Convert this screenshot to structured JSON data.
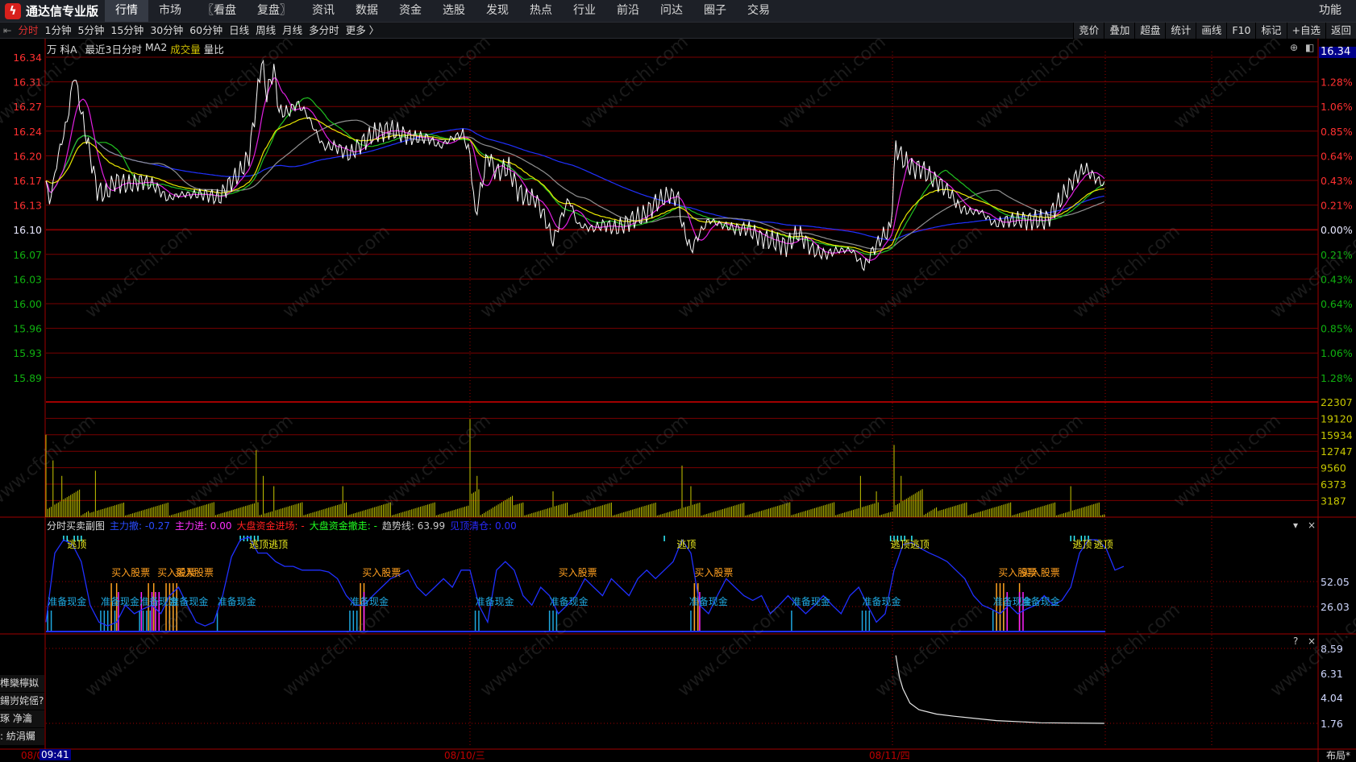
{
  "app": {
    "title": "通达信专业版",
    "logo_icon": "tdx-logo-icon"
  },
  "menu": [
    {
      "label": "行情",
      "active": true
    },
    {
      "label": "市场"
    },
    {
      "label": "〖看盘"
    },
    {
      "label": "复盘〗"
    },
    {
      "label": "资讯"
    },
    {
      "label": "数据"
    },
    {
      "label": "资金"
    },
    {
      "label": "选股"
    },
    {
      "label": "发现"
    },
    {
      "label": "热点"
    },
    {
      "label": "行业"
    },
    {
      "label": "前沿"
    },
    {
      "label": "问达"
    },
    {
      "label": "圈子"
    },
    {
      "label": "交易"
    }
  ],
  "func_label": "功能",
  "periods": [
    {
      "label": "分时",
      "active": true
    },
    {
      "label": "1分钟"
    },
    {
      "label": "5分钟"
    },
    {
      "label": "15分钟"
    },
    {
      "label": "30分钟"
    },
    {
      "label": "60分钟"
    },
    {
      "label": "日线"
    },
    {
      "label": "周线"
    },
    {
      "label": "月线"
    },
    {
      "label": "多分时"
    },
    {
      "label": "更多 〉"
    }
  ],
  "right_tools": [
    "竞价",
    "叠加",
    "超盘",
    "统计",
    "画线",
    "F10",
    "标记",
    "+自选",
    "返回"
  ],
  "title_row": {
    "stock": "万 科A",
    "mode": "最近3日分时",
    "ma": "MA2",
    "volume": "成交量",
    "ratio": "量比"
  },
  "current_price_tag": "16.34",
  "price_axis": {
    "base": 16.1,
    "left": [
      "16.34",
      "16.31",
      "16.27",
      "16.24",
      "16.20",
      "16.17",
      "16.13",
      "16.10",
      "16.07",
      "16.03",
      "16.00",
      "15.96",
      "15.93",
      "15.89"
    ],
    "right": [
      "1.28%",
      "1.06%",
      "0.85%",
      "0.64%",
      "0.43%",
      "0.21%",
      "0.00%",
      "0.21%",
      "0.43%",
      "0.64%",
      "0.85%",
      "1.06%",
      "1.28%"
    ]
  },
  "volume_axis": [
    "22307",
    "19120",
    "15934",
    "12747",
    "9560",
    "6373",
    "3187"
  ],
  "sub1": {
    "title": "分时买卖副图",
    "items": [
      {
        "label": "主力撤: -0.27",
        "color": "#2a4cff"
      },
      {
        "label": "主力进: 0.00",
        "color": "#ff30ff"
      },
      {
        "label": "大盘资金进场: -",
        "color": "#ff2020"
      },
      {
        "label": "大盘资金撤走: -",
        "color": "#20ff20"
      },
      {
        "label": "趋势线: 63.99",
        "color": "#c8c8c8"
      },
      {
        "label": "见顶清仓: 0.00",
        "color": "#2a2aff"
      }
    ],
    "axis": [
      "52.05",
      "26.03"
    ]
  },
  "sub2": {
    "axis": [
      "8.59",
      "6.31",
      "4.04",
      "1.76"
    ],
    "help": "?",
    "close": "×"
  },
  "sub1_controls": {
    "menu": "▾",
    "close": "×"
  },
  "side_items": [
    "榫欒檸姒",
    "鍚岃姹傜?",
    "琢   净瀹",
    ":  紡涓孎"
  ],
  "time_axis": {
    "dates": [
      "08/0",
      "08/10/三",
      "08/11/四"
    ],
    "cursor_time": "09:41",
    "layout": "布局*"
  },
  "watermark": "www.cfchi.com",
  "colors": {
    "up": "#ff3030",
    "down": "#10b010",
    "grid": "#7a0000",
    "volume": "#c8c800"
  },
  "chart_data": {
    "type": "line",
    "minutes_total": 720,
    "price": [
      [
        0,
        16.167
      ],
      [
        2,
        16.136
      ],
      [
        7,
        16.203
      ],
      [
        12,
        16.251
      ],
      [
        16,
        16.318
      ],
      [
        20,
        16.263
      ],
      [
        25,
        16.203
      ],
      [
        29,
        16.154
      ],
      [
        34,
        16.148
      ],
      [
        39,
        16.167
      ],
      [
        47,
        16.161
      ],
      [
        54,
        16.167
      ],
      [
        61,
        16.161
      ],
      [
        69,
        16.142
      ],
      [
        76,
        16.148
      ],
      [
        83,
        16.148
      ],
      [
        91,
        16.148
      ],
      [
        98,
        16.142
      ],
      [
        103,
        16.161
      ],
      [
        110,
        16.179
      ],
      [
        115,
        16.203
      ],
      [
        119,
        16.275
      ],
      [
        122,
        16.336
      ],
      [
        125,
        16.288
      ],
      [
        129,
        16.324
      ],
      [
        132,
        16.263
      ],
      [
        137,
        16.263
      ],
      [
        142,
        16.275
      ],
      [
        147,
        16.263
      ],
      [
        152,
        16.239
      ],
      [
        157,
        16.215
      ],
      [
        164,
        16.215
      ],
      [
        172,
        16.203
      ],
      [
        179,
        16.221
      ],
      [
        186,
        16.233
      ],
      [
        194,
        16.239
      ],
      [
        201,
        16.233
      ],
      [
        208,
        16.227
      ],
      [
        216,
        16.227
      ],
      [
        223,
        16.215
      ],
      [
        230,
        16.227
      ],
      [
        236,
        16.233
      ],
      [
        240,
        16.203
      ],
      [
        243,
        16.118
      ],
      [
        245,
        16.142
      ],
      [
        250,
        16.203
      ],
      [
        255,
        16.179
      ],
      [
        262,
        16.185
      ],
      [
        267,
        16.154
      ],
      [
        272,
        16.142
      ],
      [
        277,
        16.142
      ],
      [
        282,
        16.118
      ],
      [
        287,
        16.082
      ],
      [
        292,
        16.118
      ],
      [
        296,
        16.142
      ],
      [
        301,
        16.106
      ],
      [
        309,
        16.1
      ],
      [
        316,
        16.106
      ],
      [
        323,
        16.1
      ],
      [
        331,
        16.112
      ],
      [
        338,
        16.118
      ],
      [
        345,
        16.136
      ],
      [
        353,
        16.148
      ],
      [
        358,
        16.142
      ],
      [
        360,
        16.106
      ],
      [
        365,
        16.07
      ],
      [
        370,
        16.094
      ],
      [
        375,
        16.112
      ],
      [
        382,
        16.106
      ],
      [
        390,
        16.1
      ],
      [
        397,
        16.1
      ],
      [
        404,
        16.088
      ],
      [
        412,
        16.082
      ],
      [
        419,
        16.076
      ],
      [
        426,
        16.094
      ],
      [
        434,
        16.07
      ],
      [
        441,
        16.064
      ],
      [
        448,
        16.07
      ],
      [
        456,
        16.07
      ],
      [
        463,
        16.046
      ],
      [
        468,
        16.07
      ],
      [
        473,
        16.088
      ],
      [
        478,
        16.1
      ],
      [
        481,
        16.215
      ],
      [
        485,
        16.197
      ],
      [
        490,
        16.185
      ],
      [
        495,
        16.185
      ],
      [
        500,
        16.173
      ],
      [
        507,
        16.161
      ],
      [
        512,
        16.148
      ],
      [
        517,
        16.13
      ],
      [
        522,
        16.124
      ],
      [
        529,
        16.124
      ],
      [
        537,
        16.106
      ],
      [
        544,
        16.112
      ],
      [
        551,
        16.112
      ],
      [
        559,
        16.112
      ],
      [
        566,
        16.112
      ],
      [
        573,
        16.136
      ],
      [
        581,
        16.167
      ],
      [
        588,
        16.185
      ],
      [
        593,
        16.173
      ],
      [
        599,
        16.161
      ]
    ],
    "volume_spikes": [
      [
        0,
        16000
      ],
      [
        4,
        11000
      ],
      [
        9,
        8000
      ],
      [
        28,
        9000
      ],
      [
        119,
        13000
      ],
      [
        123,
        8000
      ],
      [
        129,
        6000
      ],
      [
        168,
        6000
      ],
      [
        240,
        19000
      ],
      [
        244,
        8000
      ],
      [
        287,
        5000
      ],
      [
        360,
        10000
      ],
      [
        365,
        6000
      ],
      [
        461,
        8000
      ],
      [
        470,
        5000
      ],
      [
        480,
        14000
      ],
      [
        484,
        8000
      ],
      [
        580,
        6000
      ]
    ],
    "trend": {
      "step_minutes": 5,
      "values": [
        9,
        82,
        96,
        91,
        73,
        27,
        9,
        5,
        9,
        27,
        18,
        23,
        27,
        18,
        37,
        46,
        27,
        9,
        5,
        9,
        37,
        78,
        96,
        99,
        82,
        82,
        73,
        68,
        68,
        64,
        64,
        64,
        62,
        55,
        37,
        27,
        27,
        37,
        46,
        55,
        59,
        64,
        46,
        37,
        46,
        55,
        46,
        64,
        64,
        27,
        9,
        64,
        73,
        64,
        37,
        27,
        46,
        37,
        18,
        27,
        37,
        55,
        46,
        37,
        55,
        46,
        37,
        55,
        64,
        55,
        64,
        73,
        96,
        82,
        27,
        18,
        37,
        55,
        46,
        37,
        32,
        37,
        18,
        27,
        37,
        27,
        18,
        27,
        37,
        27,
        18,
        37,
        46,
        27,
        9,
        18,
        64,
        91,
        93,
        87,
        82,
        78,
        73,
        64,
        55,
        37,
        27,
        23,
        18,
        27,
        18,
        23,
        27,
        37,
        27,
        32,
        46,
        82,
        96,
        96,
        87,
        64,
        68
      ]
    },
    "signals": {
      "escape": {
        "label": "逃顶",
        "minutes": [
          12,
          115,
          126,
          357,
          478,
          489,
          581,
          593
        ]
      },
      "buy": {
        "label": "买入股票",
        "minutes": [
          37,
          63,
          73,
          179,
          290,
          367,
          539,
          552
        ]
      },
      "cash": {
        "label": "准备现金",
        "minutes": [
          1,
          31,
          53,
          70,
          97,
          172,
          243,
          285,
          364,
          422,
          462,
          536,
          552
        ]
      },
      "cyan_bars": [
        1,
        3,
        31,
        33,
        35,
        37,
        39,
        53,
        55,
        57,
        59,
        70,
        72,
        74,
        97,
        172,
        174,
        176,
        243,
        245,
        285,
        287,
        289,
        365,
        367,
        369,
        422,
        462,
        464,
        466,
        536,
        538,
        540,
        542
      ],
      "orange_bars": [
        37,
        40,
        58,
        61,
        68,
        70,
        72,
        74,
        178,
        180,
        367,
        369,
        538,
        540,
        542,
        551
      ],
      "magenta_bars": [
        41,
        54,
        60,
        62,
        64,
        180,
        370,
        544,
        551,
        553
      ],
      "escape_ticks": [
        10,
        12,
        16,
        18,
        20,
        110,
        112,
        114,
        116,
        118,
        120,
        350,
        478,
        480,
        482,
        484,
        486,
        490,
        580,
        582,
        586,
        588,
        590
      ]
    },
    "sub2_curve": [
      [
        481,
        7.96
      ],
      [
        483,
        6.0
      ],
      [
        485,
        4.9
      ],
      [
        489,
        3.6
      ],
      [
        494,
        3.0
      ],
      [
        504,
        2.6
      ],
      [
        514,
        2.4
      ],
      [
        538,
        2.0
      ],
      [
        563,
        1.8
      ],
      [
        599,
        1.75
      ]
    ]
  }
}
